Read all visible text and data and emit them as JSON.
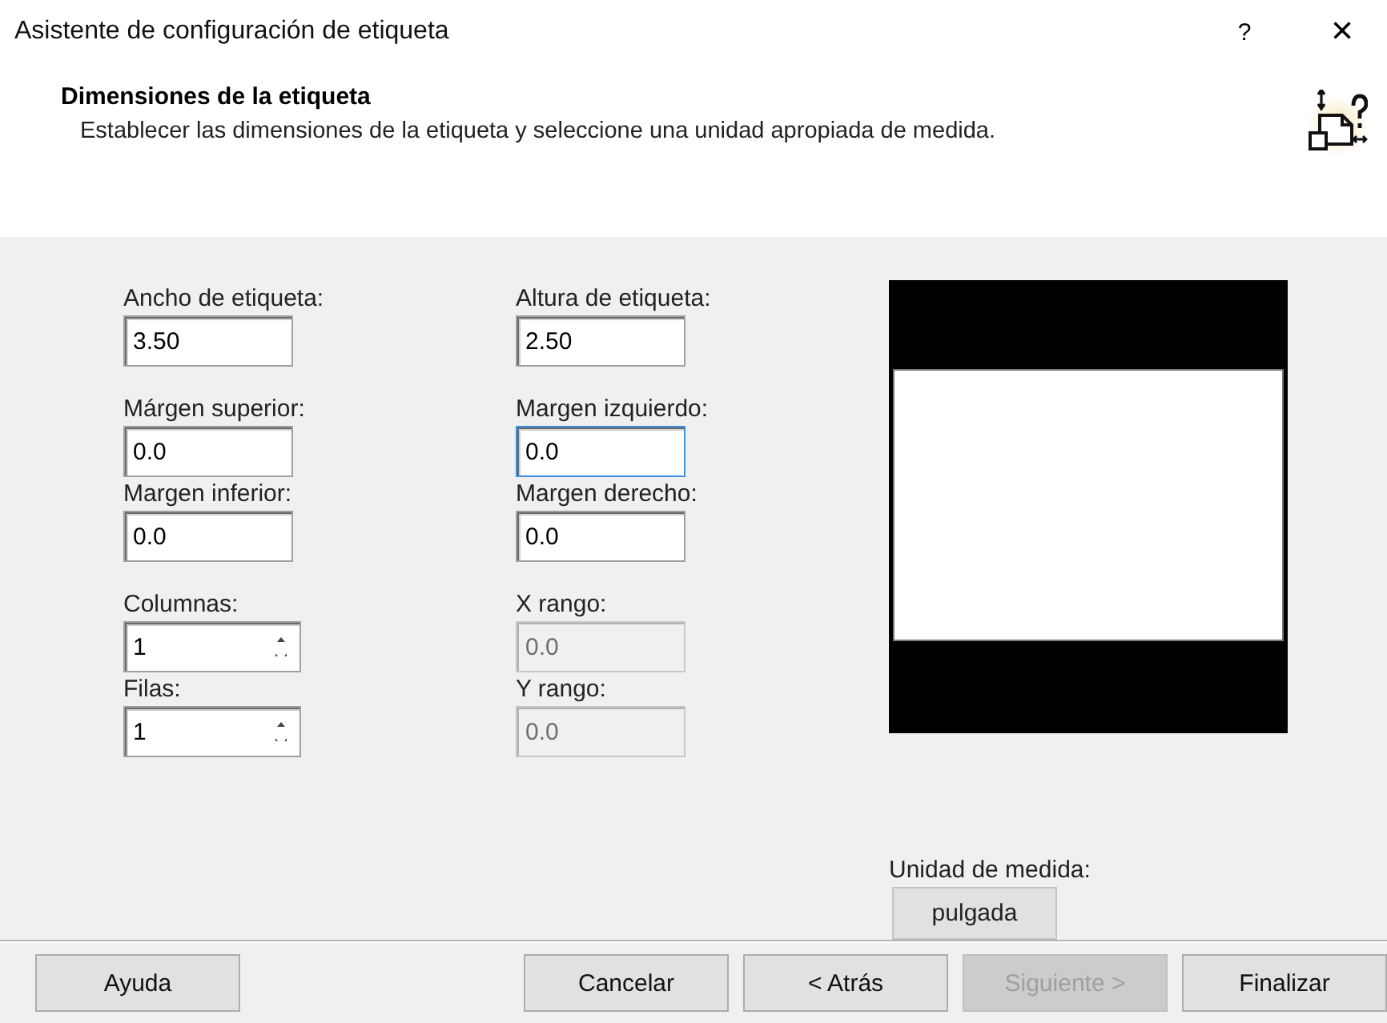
{
  "window": {
    "title": "Asistente de configuración de etiqueta",
    "help": "?",
    "close": "×"
  },
  "header": {
    "title": "Dimensiones de la etiqueta",
    "description": "Establecer las dimensiones de la etiqueta y seleccione una unidad apropiada de medida."
  },
  "columns": [
    {
      "fields": [
        {
          "label": "Ancho de etiqueta:",
          "value": "3.50",
          "kind": "text",
          "disabled": false,
          "focused": false
        },
        {
          "label": "Márgen superior:",
          "value": "0.0",
          "kind": "text",
          "disabled": false,
          "focused": false
        },
        {
          "label": "Margen inferior:",
          "value": "0.0",
          "kind": "text",
          "disabled": false,
          "focused": false
        },
        {
          "label": "Columnas:",
          "value": "1",
          "kind": "spin",
          "disabled": false,
          "focused": false
        },
        {
          "label": "Filas:",
          "value": "1",
          "kind": "spin",
          "disabled": false,
          "focused": false
        }
      ]
    },
    {
      "fields": [
        {
          "label": "Altura de etiqueta:",
          "value": "2.50",
          "kind": "text",
          "disabled": false,
          "focused": false
        },
        {
          "label": "Margen izquierdo:",
          "value": "0.0",
          "kind": "text",
          "disabled": false,
          "focused": true
        },
        {
          "label": "Margen derecho:",
          "value": "0.0",
          "kind": "text",
          "disabled": false,
          "focused": false
        },
        {
          "label": "X rango:",
          "value": "0.0",
          "kind": "text",
          "disabled": true,
          "focused": false
        },
        {
          "label": "Y rango:",
          "value": "0.0",
          "kind": "text",
          "disabled": true,
          "focused": false
        }
      ]
    }
  ],
  "unit": {
    "label": "Unidad de medida:",
    "button": "pulgada"
  },
  "buttons": [
    {
      "label": "Ayuda",
      "disabled": false
    },
    {
      "label": "Cancelar",
      "disabled": false
    },
    {
      "label": "< Atrás",
      "disabled": false
    },
    {
      "label": "Siguiente >",
      "disabled": true
    },
    {
      "label": "Finalizar",
      "disabled": false
    }
  ]
}
